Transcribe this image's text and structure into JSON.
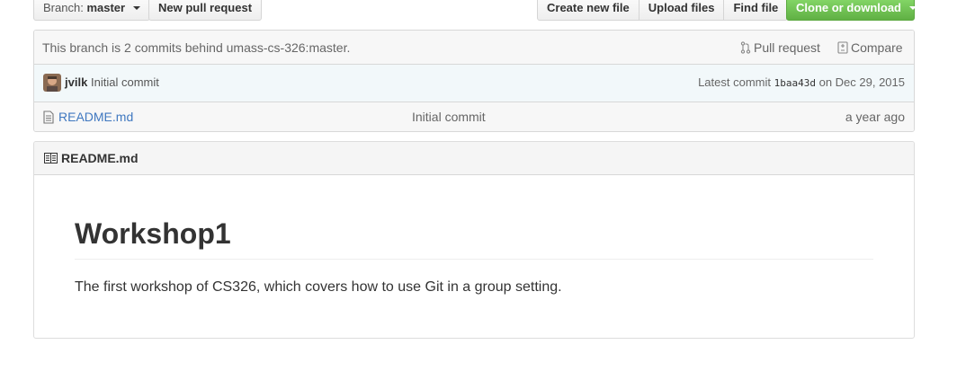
{
  "toolbar": {
    "branch_prefix": "Branch:",
    "branch_name": "master",
    "new_pull_request": "New pull request",
    "create_new_file": "Create new file",
    "upload_files": "Upload files",
    "find_file": "Find file",
    "clone_or_download": "Clone or download"
  },
  "branch_info": {
    "status": "This branch is 2 commits behind umass-cs-326:master.",
    "pull_request": "Pull request",
    "compare": "Compare"
  },
  "latest_commit": {
    "author": "jvilk",
    "message": "Initial commit",
    "prefix": "Latest commit",
    "sha": "1baa43d",
    "date_text": "on Dec 29, 2015"
  },
  "files": [
    {
      "name": "README.md",
      "message": "Initial commit",
      "age": "a year ago",
      "icon": "file-icon"
    }
  ],
  "readme": {
    "header": "README.md",
    "heading": "Workshop1",
    "paragraph": "The first workshop of CS326, which covers how to use Git in a group setting."
  },
  "colors": {
    "link": "#4078c0",
    "green_button": "#6cc644",
    "commit_bar": "#f2f8fa"
  }
}
